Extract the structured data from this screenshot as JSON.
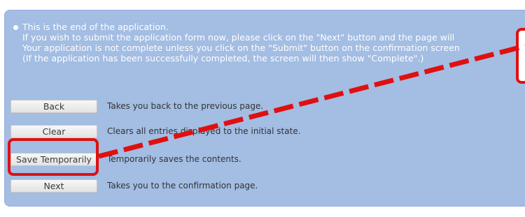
{
  "notice": {
    "lines": [
      "This is the end of the application.",
      "If you wish to submit the application form now, please click on the \"Next\" button and the page will",
      "Your application is not complete unless you click on the \"Submit\" button on the confirmation screen",
      "(If the application has been successfully completed, the screen will then show \"Complete\".)"
    ]
  },
  "actions": [
    {
      "label": "Back",
      "description": "Takes you back to the previous page."
    },
    {
      "label": "Clear",
      "description": "Clears all entries displayed to the initial state."
    },
    {
      "label": "Save Temporarily",
      "description": "Temporarily saves the contents."
    },
    {
      "label": "Next",
      "description": "Takes you to the confirmation page."
    }
  ],
  "colors": {
    "panel_background": "#a3bde3",
    "annotation_red": "#e01010"
  }
}
